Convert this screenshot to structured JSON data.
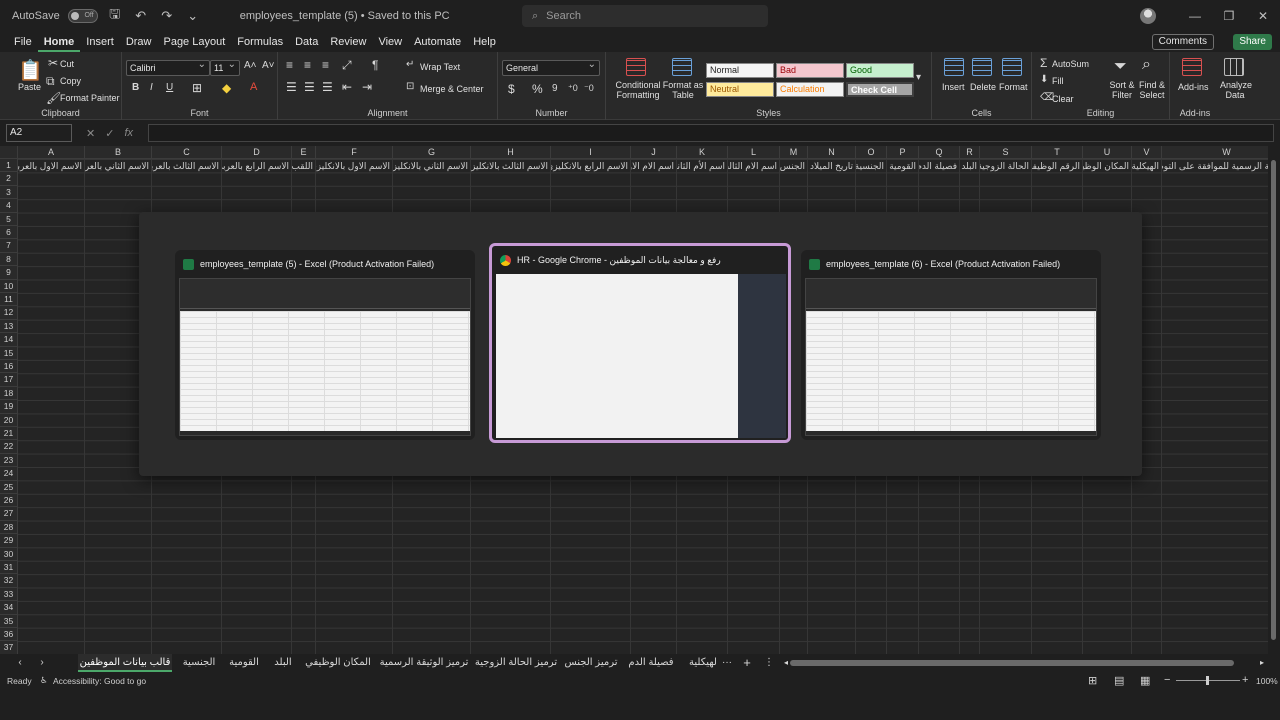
{
  "titlebar": {
    "autosave_label": "AutoSave",
    "autosave_state": "Off",
    "doc_title": "employees_template (5) • Saved to this PC",
    "search_placeholder": "Search"
  },
  "menu": {
    "items": [
      "File",
      "Home",
      "Insert",
      "Draw",
      "Page Layout",
      "Formulas",
      "Data",
      "Review",
      "View",
      "Automate",
      "Help"
    ],
    "active": "Home",
    "comments": "Comments",
    "share": "Share"
  },
  "ribbon": {
    "clipboard": {
      "paste": "Paste",
      "cut": "Cut",
      "copy": "Copy",
      "format_painter": "Format Painter",
      "label": "Clipboard"
    },
    "font": {
      "name": "Calibri",
      "size": "11",
      "label": "Font"
    },
    "alignment": {
      "wrap": "Wrap Text",
      "merge": "Merge & Center",
      "label": "Alignment"
    },
    "number": {
      "format": "General",
      "label": "Number"
    },
    "styles": {
      "conditional": "Conditional Formatting",
      "format_table": "Format as Table",
      "normal": "Normal",
      "bad": "Bad",
      "good": "Good",
      "neutral": "Neutral",
      "calculation": "Calculation",
      "check_cell": "Check Cell",
      "label": "Styles"
    },
    "cells": {
      "insert": "Insert",
      "delete": "Delete",
      "format": "Format",
      "label": "Cells"
    },
    "editing": {
      "autosum": "AutoSum",
      "fill": "Fill",
      "clear": "Clear",
      "sort": "Sort & Filter",
      "find": "Find & Select",
      "label": "Editing"
    },
    "addins": {
      "addins": "Add-ins",
      "analyze": "Analyze Data",
      "label": "Add-ins"
    }
  },
  "formula": {
    "name_box": "A2",
    "value": ""
  },
  "grid": {
    "columns": [
      "A",
      "B",
      "C",
      "D",
      "E",
      "F",
      "G",
      "H",
      "I",
      "J",
      "K",
      "L",
      "M",
      "N",
      "O",
      "P",
      "Q",
      "R",
      "S",
      "T",
      "U",
      "V",
      "W"
    ],
    "rows": [
      "1",
      "2",
      "3",
      "4",
      "5",
      "6",
      "7",
      "8",
      "9",
      "10",
      "11",
      "12",
      "13",
      "14",
      "15",
      "16",
      "17",
      "18",
      "19",
      "20",
      "21",
      "22",
      "23",
      "24",
      "25",
      "26",
      "27",
      "28",
      "29",
      "30",
      "31",
      "32",
      "33",
      "34",
      "35",
      "36",
      "37"
    ],
    "header_row": [
      "الاسم الاول بالعربي",
      "الاسم الثاني بالعربي",
      "الاسم الثالث بالعربي",
      "الاسم الرابع بالعربي",
      "اللقب",
      "الاسم الاول بالانكليزي",
      "الاسم الثاني بالانكليزي",
      "الاسم الثالث بالانكليزي",
      "الاسم الرابع بالانكليزي",
      "اسم الام الاول",
      "اسم الأم الثاني",
      "اسم الام الثالث",
      "الجنس",
      "تاريخ الميلاد",
      "الجنسية",
      "القومية",
      "فصيلة الدم",
      "البلد",
      "الحالة الزوجية",
      "الرقم الوظيفي",
      "المكان الوظيفي",
      "الهيكلية",
      "الوثيقة الرسمية للموافقة على التوظيف"
    ]
  },
  "switcher": {
    "windows": [
      {
        "title": "employees_template (5) - Excel (Product Activation Failed)",
        "app": "excel"
      },
      {
        "title": "HR - Google Chrome - رفع و معالجة بيانات الموظفين",
        "app": "chrome"
      },
      {
        "title": "employees_template (6) - Excel (Product Activation Failed)",
        "app": "excel"
      }
    ]
  },
  "sheets": {
    "tabs": [
      "قالب بيانات الموظفين",
      "الجنسية",
      "القومية",
      "البلد",
      "المكان الوظيفي",
      "ترميز الوثيقة الرسمية",
      "ترميز الحالة الزوجية",
      "ترميز الجنس",
      "فصيلة الدم",
      "لهيكلية"
    ],
    "active": "قالب بيانات الموظفين",
    "more": "···",
    "add": "+"
  },
  "status": {
    "ready": "Ready",
    "accessibility": "Accessibility: Good to go",
    "zoom": "100%"
  }
}
